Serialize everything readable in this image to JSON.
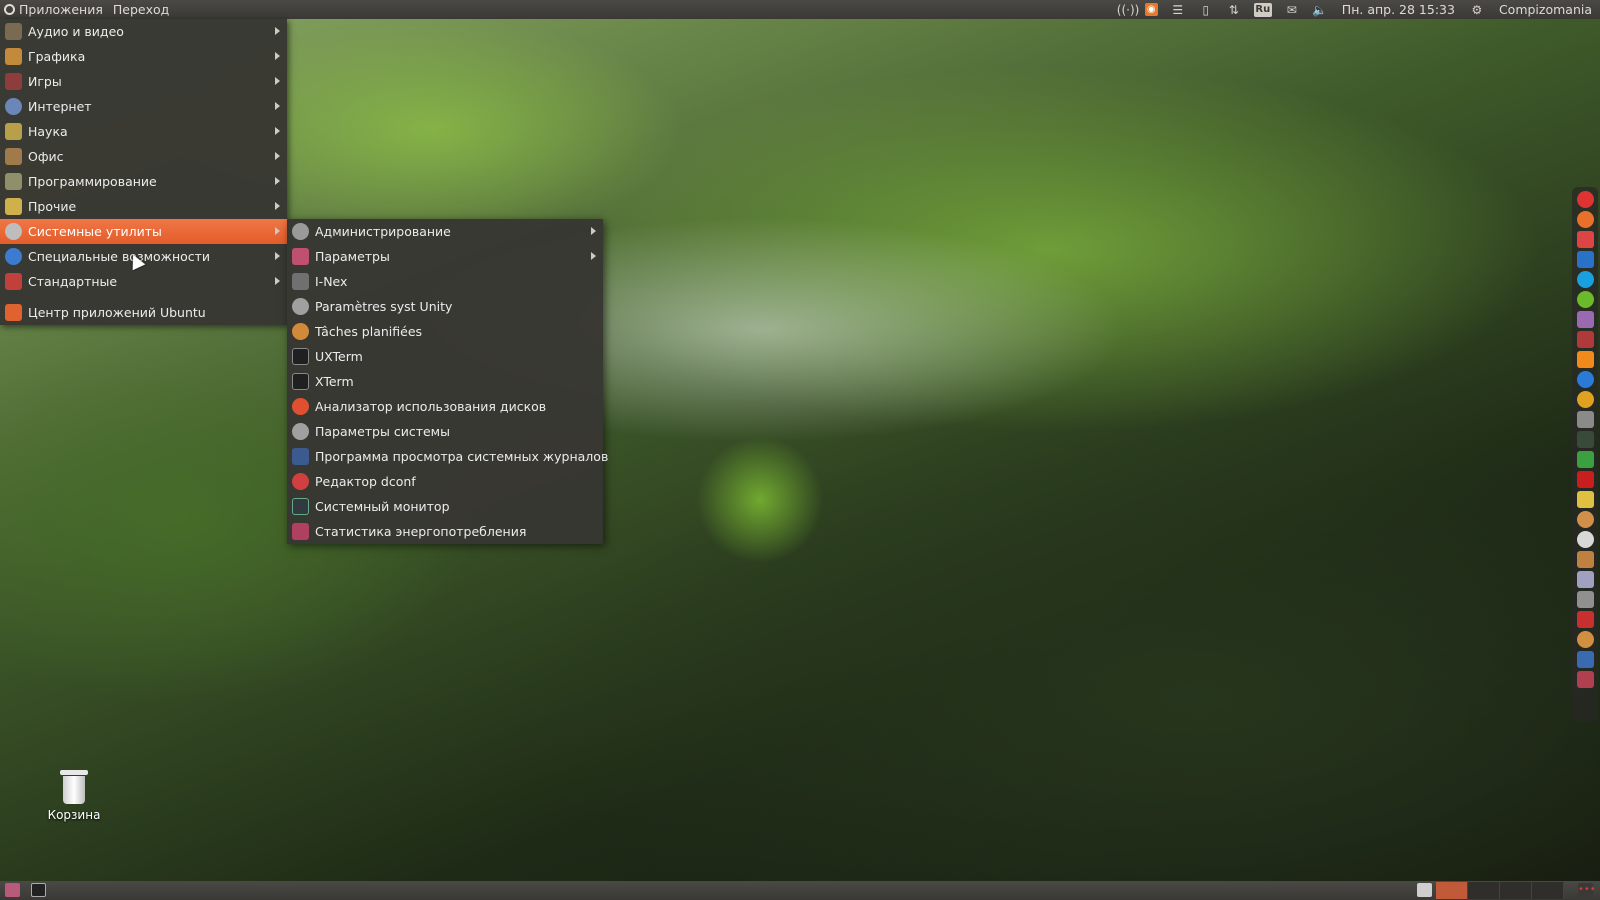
{
  "top_panel": {
    "applications_label": "Приложения",
    "places_label": "Переход",
    "lang_indicator": "Ru",
    "clock": "Пн. апр. 28 15:33",
    "user_name": "Compizomania",
    "tray_icons": [
      "network-icon",
      "rss-icon",
      "notes-icon",
      "clipboard-icon",
      "transfer-icon",
      "keyboard-layout-icon",
      "mail-icon",
      "volume-icon",
      "gear-icon"
    ]
  },
  "applications_menu": {
    "items": [
      {
        "label": "Аудио и видео",
        "icon": "audio-video-icon",
        "color": "#7a6a52"
      },
      {
        "label": "Графика",
        "icon": "graphics-icon",
        "color": "#c38a3b"
      },
      {
        "label": "Игры",
        "icon": "games-icon",
        "color": "#8e3c3c"
      },
      {
        "label": "Интернет",
        "icon": "internet-icon",
        "color": "#6b86b8"
      },
      {
        "label": "Наука",
        "icon": "science-icon",
        "color": "#b8a04a"
      },
      {
        "label": "Офис",
        "icon": "office-icon",
        "color": "#a07a4a"
      },
      {
        "label": "Программирование",
        "icon": "programming-icon",
        "color": "#8f8f6a"
      },
      {
        "label": "Прочие",
        "icon": "other-icon",
        "color": "#d0b04a"
      },
      {
        "label": "Системные утилиты",
        "icon": "system-tools-icon",
        "color": "#bdbdbd"
      },
      {
        "label": "Специальные возможности",
        "icon": "accessibility-icon",
        "color": "#3d7bd1"
      },
      {
        "label": "Стандартные",
        "icon": "accessories-icon",
        "color": "#c0403b"
      }
    ],
    "extra_item": {
      "label": "Центр приложений Ubuntu",
      "icon": "software-center-icon",
      "color": "#e0622e"
    }
  },
  "system_tools_submenu": {
    "items": [
      {
        "label": "Администрирование",
        "icon": "administration-icon",
        "color": "#9a9a9a",
        "has_submenu": true
      },
      {
        "label": "Параметры",
        "icon": "preferences-icon",
        "color": "#c05070",
        "has_submenu": true
      },
      {
        "label": "I-Nex",
        "icon": "inex-icon",
        "color": "#707070",
        "has_submenu": false
      },
      {
        "label": "Paramètres syst Unity",
        "icon": "unity-settings-icon",
        "color": "#a0a0a0",
        "has_submenu": false
      },
      {
        "label": "Tâches planifiées",
        "icon": "scheduled-tasks-icon",
        "color": "#d08a3a",
        "has_submenu": false
      },
      {
        "label": "UXTerm",
        "icon": "uxterm-icon",
        "color": "#202020",
        "has_submenu": false
      },
      {
        "label": "XTerm",
        "icon": "xterm-icon",
        "color": "#202020",
        "has_submenu": false
      },
      {
        "label": "Анализатор использования дисков",
        "icon": "disk-usage-icon",
        "color": "#e05030",
        "has_submenu": false
      },
      {
        "label": "Параметры системы",
        "icon": "system-settings-icon",
        "color": "#a0a0a0",
        "has_submenu": false
      },
      {
        "label": "Программа просмотра системных журналов",
        "icon": "log-viewer-icon",
        "color": "#3a5a90",
        "has_submenu": false
      },
      {
        "label": "Редактор dconf",
        "icon": "dconf-editor-icon",
        "color": "#d04040",
        "has_submenu": false
      },
      {
        "label": "Системный монитор",
        "icon": "system-monitor-icon",
        "color": "#303a40",
        "has_submenu": false
      },
      {
        "label": "Статистика энергопотребления",
        "icon": "power-statistics-icon",
        "color": "#b04060",
        "has_submenu": false
      }
    ]
  },
  "desktop": {
    "trash_label": "Корзина"
  },
  "dock": {
    "icons": [
      {
        "name": "close-icon",
        "color": "#d33"
      },
      {
        "name": "firefox-icon",
        "color": "#e8702a"
      },
      {
        "name": "gmail-icon",
        "color": "#d44"
      },
      {
        "name": "outlook-icon",
        "color": "#2a72c8"
      },
      {
        "name": "skype-icon",
        "color": "#18a0e0"
      },
      {
        "name": "spotify-icon",
        "color": "#6aba2a"
      },
      {
        "name": "deezer-icon",
        "color": "#9a6ab0"
      },
      {
        "name": "cube-icon",
        "color": "#b03a3a"
      },
      {
        "name": "vlc-icon",
        "color": "#f08a1a"
      },
      {
        "name": "player-icon",
        "color": "#2a7ad8"
      },
      {
        "name": "ubuntu-one-icon",
        "color": "#e0a020"
      },
      {
        "name": "window-icon",
        "color": "#8a8a8a"
      },
      {
        "name": "monitor-icon",
        "color": "#3a4a3a"
      },
      {
        "name": "sync-icon",
        "color": "#3aa040"
      },
      {
        "name": "filezilla-icon",
        "color": "#c81e1e"
      },
      {
        "name": "character-icon",
        "color": "#e0c040"
      },
      {
        "name": "tools-icon",
        "color": "#d0904a"
      },
      {
        "name": "disc-icon",
        "color": "#d8d8d8"
      },
      {
        "name": "package-icon",
        "color": "#c08040"
      },
      {
        "name": "image-icon",
        "color": "#a0a0c0"
      },
      {
        "name": "camera-icon",
        "color": "#909090"
      },
      {
        "name": "calendar-icon",
        "color": "#c83030"
      },
      {
        "name": "clock-icon",
        "color": "#d09040"
      },
      {
        "name": "webcam-icon",
        "color": "#3a6ab0"
      },
      {
        "name": "app-icon",
        "color": "#b04050"
      }
    ]
  },
  "bottom_panel": {
    "show_desktop_icon": "show-desktop-icon",
    "terminal_icon": "terminal-icon",
    "trash_applet_icon": "trash-applet-icon"
  }
}
